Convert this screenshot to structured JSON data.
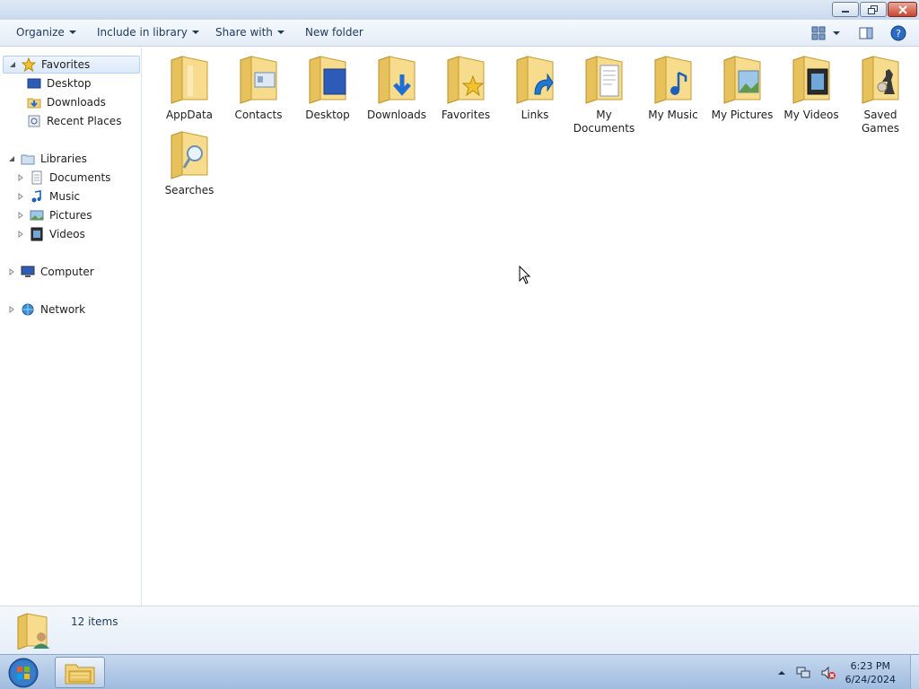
{
  "window": {
    "controls": {
      "minimize_icon": "minimize-icon",
      "restore_icon": "restore-icon",
      "close_icon": "close-icon"
    }
  },
  "toolbar": {
    "organize": "Organize",
    "include_in_library": "Include in library",
    "share_with": "Share with",
    "new_folder": "New folder"
  },
  "nav": {
    "favorites": {
      "label": "Favorites",
      "items": [
        "Desktop",
        "Downloads",
        "Recent Places"
      ]
    },
    "libraries": {
      "label": "Libraries",
      "items": [
        "Documents",
        "Music",
        "Pictures",
        "Videos"
      ]
    },
    "computer": "Computer",
    "network": "Network"
  },
  "folders": [
    {
      "label": "AppData",
      "icon": "folder-icon"
    },
    {
      "label": "Contacts",
      "icon": "contacts-folder-icon"
    },
    {
      "label": "Desktop",
      "icon": "desktop-folder-icon"
    },
    {
      "label": "Downloads",
      "icon": "downloads-folder-icon"
    },
    {
      "label": "Favorites",
      "icon": "favorites-folder-icon"
    },
    {
      "label": "Links",
      "icon": "links-folder-icon"
    },
    {
      "label": "My Documents",
      "icon": "documents-folder-icon"
    },
    {
      "label": "My Music",
      "icon": "music-folder-icon"
    },
    {
      "label": "My Pictures",
      "icon": "pictures-folder-icon"
    },
    {
      "label": "My Videos",
      "icon": "videos-folder-icon"
    },
    {
      "label": "Saved Games",
      "icon": "games-folder-icon"
    },
    {
      "label": "Searches",
      "icon": "searches-folder-icon"
    }
  ],
  "details": {
    "count": "12 items"
  },
  "taskbar": {
    "time": "6:23 PM",
    "date": "6/24/2024"
  },
  "colors": {
    "folder": "#f3d27a",
    "accent": "#1e395b",
    "selection": "#dbe9fa"
  }
}
